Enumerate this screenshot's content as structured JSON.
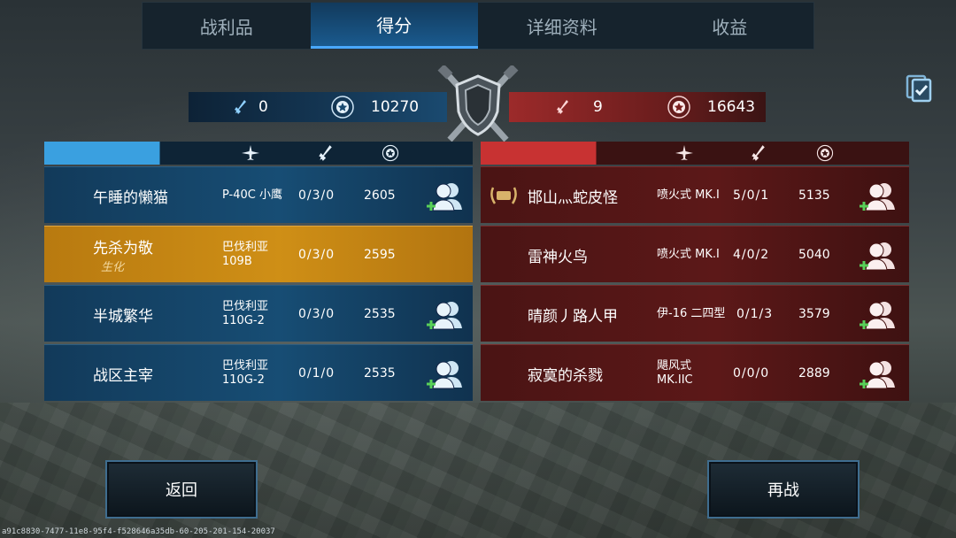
{
  "tabs": [
    {
      "label": "战利品",
      "active": false
    },
    {
      "label": "得分",
      "active": true
    },
    {
      "label": "详细资料",
      "active": false
    },
    {
      "label": "收益",
      "active": false
    }
  ],
  "scoreboard": {
    "blue": {
      "kills": "0",
      "score": "10270"
    },
    "red": {
      "kills": "9",
      "score": "16643"
    }
  },
  "blue_team": [
    {
      "name": "午睡的懒猫",
      "plane": "P-40C 小鹰",
      "kda": "0/3/0",
      "score": "2605",
      "highlight": false
    },
    {
      "name": "先杀为敬",
      "badge": "生化",
      "plane": "巴伐利亚109B",
      "kda": "0/3/0",
      "score": "2595",
      "highlight": true
    },
    {
      "name": "半城繁华",
      "plane": "巴伐利亚110G-2",
      "kda": "0/3/0",
      "score": "2535",
      "highlight": false
    },
    {
      "name": "战区主宰",
      "plane": "巴伐利亚110G-2",
      "kda": "0/1/0",
      "score": "2535",
      "highlight": false
    }
  ],
  "red_team": [
    {
      "name": "邯山灬蛇皮怪",
      "plane": "喷火式 MK.I",
      "kda": "5/0/1",
      "score": "5135",
      "medal": true
    },
    {
      "name": "雷神火鸟",
      "plane": "喷火式 MK.I",
      "kda": "4/0/2",
      "score": "5040",
      "medal": false
    },
    {
      "name": "晴颜丿路人甲",
      "plane": "伊-16 二四型",
      "kda": "0/1/3",
      "score": "3579",
      "medal": false
    },
    {
      "name": "寂寞的杀戮",
      "plane": "飓风式 MK.IIC",
      "kda": "0/0/0",
      "score": "2889",
      "medal": false
    }
  ],
  "buttons": {
    "back": "返回",
    "rematch": "再战"
  },
  "footer_id": "a91c8830-7477-11e8-95f4-f528646a35db-60-205-201-154-20037",
  "colors": {
    "blue_team": "#1a4a70",
    "red_team": "#7a1f1f",
    "highlight": "#cf8f16",
    "accent": "#49a8ff"
  },
  "icons": {
    "clipboard": "clipboard-check-icon",
    "plane": "plane-icon",
    "sword": "sword-icon",
    "star": "star-laurel-icon",
    "add_friend": "add-friend-icon",
    "medal": "medal-icon",
    "emblem": "crossed-swords-shield-icon"
  }
}
